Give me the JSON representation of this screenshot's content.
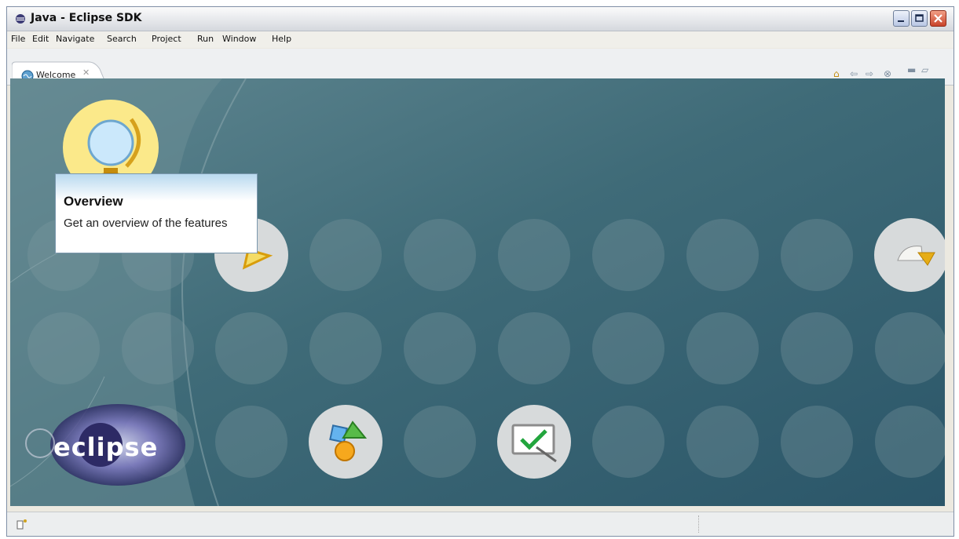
{
  "window": {
    "title": "Java - Eclipse SDK"
  },
  "menubar": {
    "items": [
      "File",
      "Edit",
      "Navigate",
      "Search",
      "Project",
      "Run",
      "Window",
      "Help"
    ]
  },
  "tab": {
    "label": "Welcome"
  },
  "toolbar_icons": [
    "home-icon",
    "back-icon",
    "forward-icon",
    "customize-icon",
    "minimize-view-icon",
    "maximize-view-icon"
  ],
  "welcome": {
    "tooltip": {
      "title": "Overview",
      "description": "Get an overview of the features"
    },
    "logo_text": "eclipse",
    "launcher_icons": [
      "globe-icon",
      "star-icon",
      "arrow-page-icon",
      "shapes-icon",
      "checklist-icon"
    ]
  },
  "colors": {
    "background_start": "#5a7f89",
    "background_end": "#2f5a6d",
    "tooltip_title": "#111111"
  }
}
